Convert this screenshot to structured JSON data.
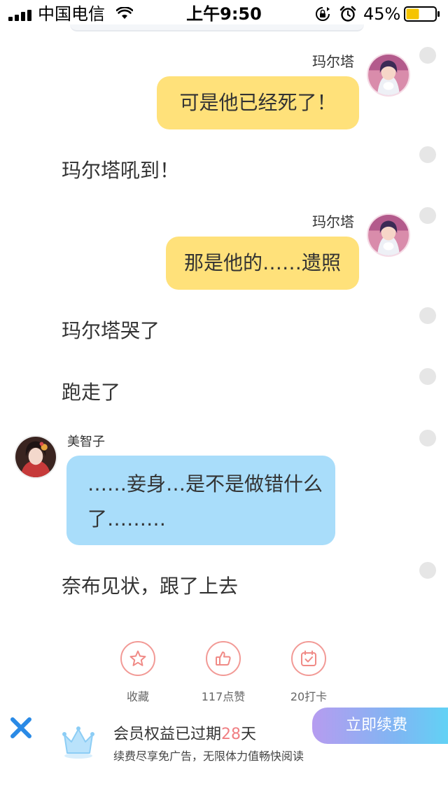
{
  "status_bar": {
    "carrier": "中国电信",
    "time": "上午9:50",
    "battery_percent": "45%",
    "battery_level": 0.45,
    "battery_color": "#f5c400"
  },
  "messages": [
    {
      "kind": "character-right",
      "speaker": "玛尔塔",
      "text": "可是他已经死了！"
    },
    {
      "kind": "narration",
      "text": "玛尔塔吼到！"
    },
    {
      "kind": "character-right",
      "speaker": "玛尔塔",
      "text": "那是他的……遗照"
    },
    {
      "kind": "narration",
      "text": "玛尔塔哭了"
    },
    {
      "kind": "narration",
      "text": "跑走了"
    },
    {
      "kind": "character-left",
      "speaker": "美智子",
      "text_line1": "……妾身…是不是做错什么",
      "text_line2": "了………"
    },
    {
      "kind": "narration",
      "text": "奈布见状，跟了上去"
    }
  ],
  "actions": {
    "favorite_label": "收藏",
    "like_label": "117点赞",
    "checkin_label": "20打卡"
  },
  "banner": {
    "title_prefix": "会员权益已过期",
    "days": "28",
    "title_suffix": "天",
    "subtitle": "续费尽享免广告，无限体力值畅快阅读",
    "renew_label": "立即续费"
  },
  "colors": {
    "yellow_bubble": "#ffe17a",
    "blue_bubble": "#a9ddfa",
    "accent_pink": "#f07f83",
    "close_blue": "#2a8ae6"
  }
}
